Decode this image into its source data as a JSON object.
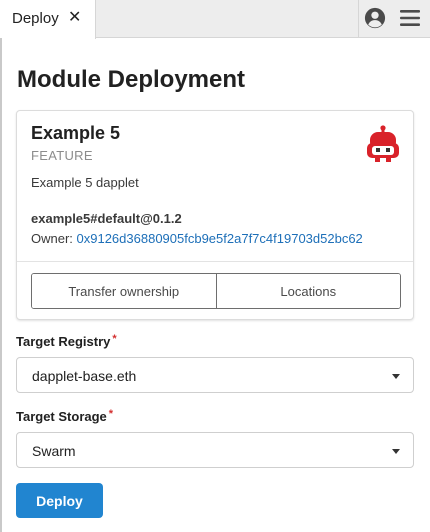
{
  "tab": {
    "label": "Deploy",
    "close_glyph": "✕"
  },
  "toolbar": {
    "avatar_icon": "account-circle-icon",
    "menu_icon": "hamburger-menu-icon"
  },
  "page": {
    "title": "Module Deployment"
  },
  "card": {
    "title": "Example 5",
    "type": "FEATURE",
    "description": "Example 5 dapplet",
    "version": "example5#default@0.1.2",
    "owner_label": "Owner: ",
    "owner_address": "0x9126d36880905fcb9e5f2a7f7c4f19703d52bc62",
    "icon": "robot-icon",
    "buttons": {
      "transfer": "Transfer ownership",
      "locations": "Locations"
    }
  },
  "form": {
    "registry": {
      "label": "Target Registry",
      "required_mark": "*",
      "value": "dapplet-base.eth"
    },
    "storage": {
      "label": "Target Storage",
      "required_mark": "*",
      "value": "Swarm"
    }
  },
  "actions": {
    "deploy_label": "Deploy"
  },
  "colors": {
    "accent": "#2185d0",
    "link": "#1d6fb8",
    "required": "#d32f2f",
    "robot": "#d9222a"
  }
}
